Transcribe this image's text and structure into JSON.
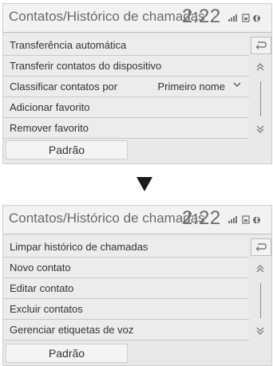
{
  "screen1": {
    "title": "Contatos/Histórico de chamadas",
    "clock": "2:22",
    "status_icons": [
      "signal-icon",
      "battery-icon",
      "bluetooth-icon"
    ],
    "rows": [
      {
        "label": "Transferência automática",
        "value": ""
      },
      {
        "label": "Transferir contatos do dispositivo",
        "value": ""
      },
      {
        "label": "Classificar contatos por",
        "value": "Primeiro nome"
      },
      {
        "label": "Adicionar favorito",
        "value": ""
      },
      {
        "label": "Remover favorito",
        "value": ""
      }
    ],
    "default_button": "Padrão"
  },
  "transition_icon": "down-triangle-icon",
  "screen2": {
    "title": "Contatos/Histórico de chamadas",
    "clock": "2:22",
    "status_icons": [
      "signal-icon",
      "battery-icon",
      "bluetooth-icon"
    ],
    "rows": [
      {
        "label": "Limpar histórico de chamadas"
      },
      {
        "label": "Novo contato"
      },
      {
        "label": "Editar contato"
      },
      {
        "label": "Excluir contatos"
      },
      {
        "label": "Gerenciar etiquetas de voz"
      }
    ],
    "default_button": "Padrão"
  },
  "icons": {
    "back": "back-icon",
    "scroll_up": "scroll-up-icon",
    "scroll_down": "scroll-down-icon",
    "dropdown": "chevron-down-icon"
  }
}
